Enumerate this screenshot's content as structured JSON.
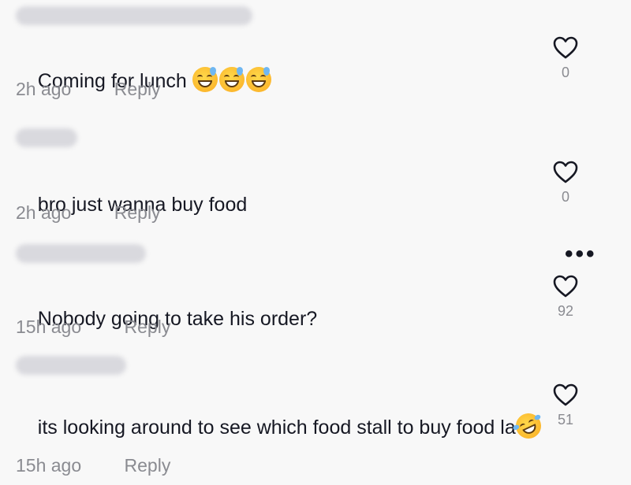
{
  "comments": [
    {
      "text": "Coming for lunch ",
      "emojis": [
        "grinning-sweat-emoji",
        "grinning-sweat-emoji",
        "grinning-sweat-emoji"
      ],
      "time": "2h ago",
      "reply_label": "Reply",
      "likes": "0"
    },
    {
      "text": "bro just wanna buy food",
      "time": "2h ago",
      "reply_label": "Reply",
      "likes": "0"
    },
    {
      "text": "Nobody going to take his order?",
      "time": "15h ago",
      "reply_label": "Reply",
      "likes": "92"
    },
    {
      "text": "its looking around to see which food stall to buy food la",
      "emojis": [
        "rolling-laughing-emoji"
      ],
      "time": "15h ago",
      "reply_label": "Reply",
      "likes": "51"
    }
  ],
  "more_options": "•••",
  "icons": {
    "like": "heart-outline-icon",
    "more": "more-options-icon"
  },
  "colors": {
    "background": "#f8f8f8",
    "text": "#161823",
    "muted": "#8a8b91"
  }
}
